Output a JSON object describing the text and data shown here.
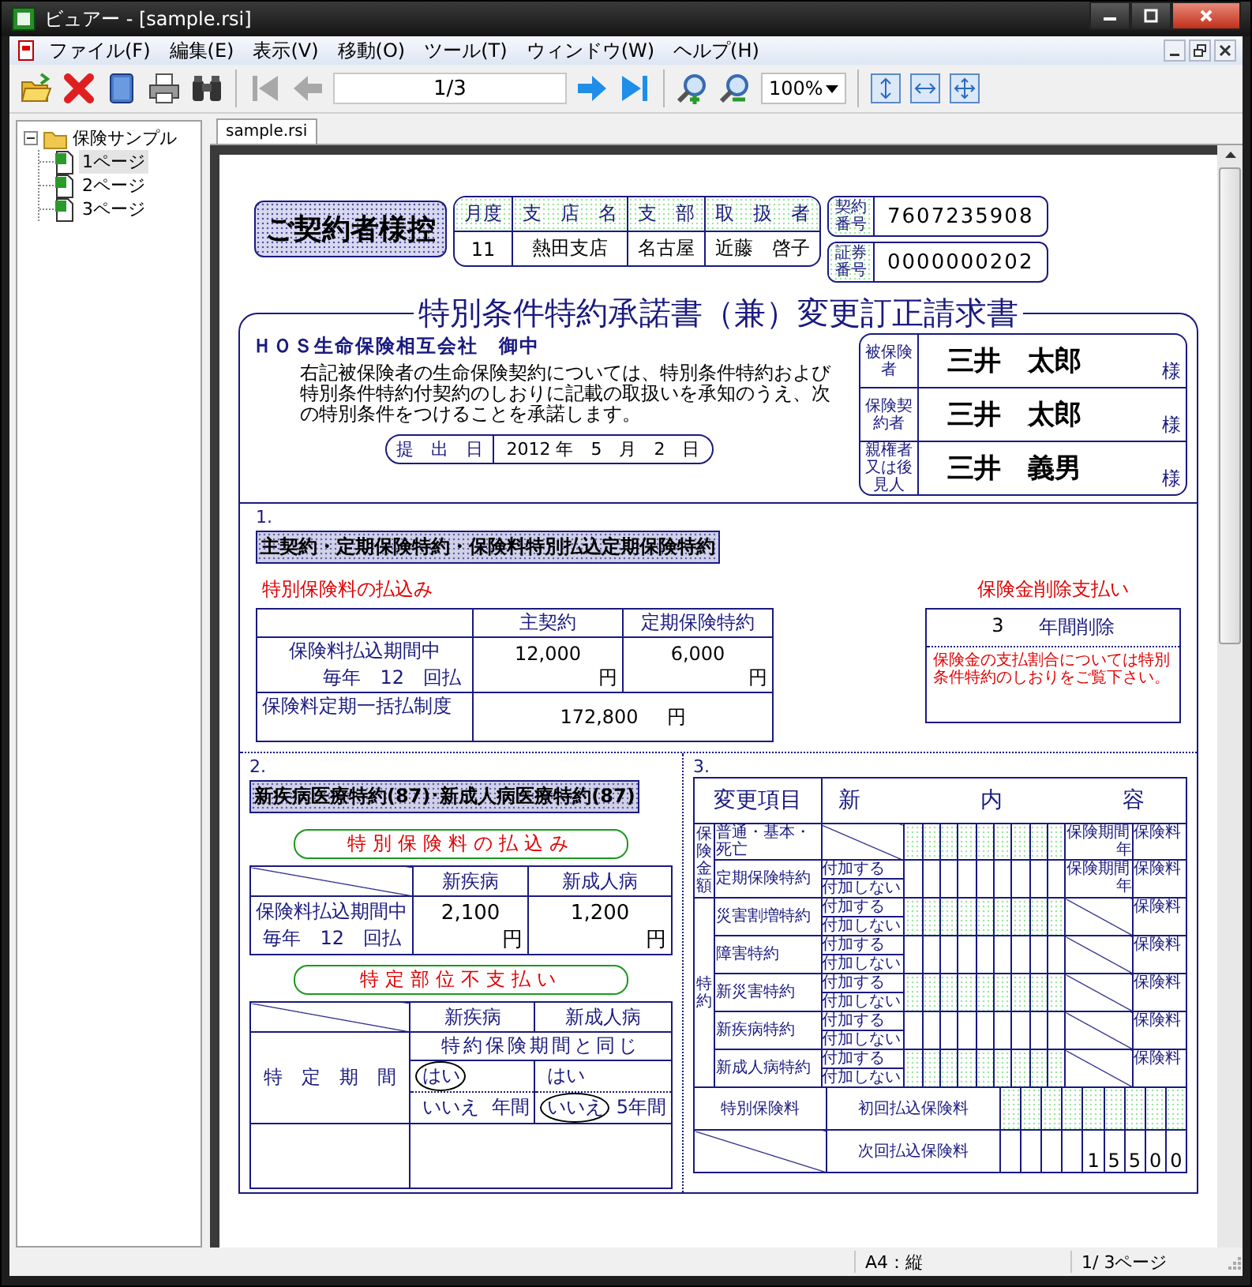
{
  "window": {
    "title": "ビュアー - [sample.rsi]"
  },
  "menu": [
    {
      "label": "ファイル(F)"
    },
    {
      "label": "編集(E)"
    },
    {
      "label": "表示(V)"
    },
    {
      "label": "移動(O)"
    },
    {
      "label": "ツール(T)"
    },
    {
      "label": "ウィンドウ(W)"
    },
    {
      "label": "ヘルプ(H)"
    }
  ],
  "toolbar": {
    "first_disabled": true,
    "previous_disabled": true,
    "next_disabled": false,
    "last_disabled": false,
    "page": "1/3",
    "zoom": "100%"
  },
  "tree": {
    "label": "保険サンプル",
    "expanded": true,
    "children": [
      {
        "label": "1ページ",
        "selected": true
      },
      {
        "label": "2ページ",
        "selected": false
      },
      {
        "label": "3ページ",
        "selected": false
      }
    ]
  },
  "tabs": [
    {
      "label": "sample.rsi",
      "selected": true
    }
  ],
  "document": {
    "header": {
      "stamp": "ご契約者様控",
      "agency_columns": [
        "月度",
        "支　店　名",
        "支　部",
        "取　扱　者"
      ],
      "agency_values": [
        "11",
        "熱田支店",
        "名古屋",
        "近藤　啓子"
      ],
      "numbers": [
        {
          "label": "契約番号",
          "value": "7607235908"
        },
        {
          "label": "証券番号",
          "value": "0000000202"
        }
      ]
    },
    "title": "特別条件特約承諾書（兼）変更訂正請求書",
    "addressee": "ＨＯＳ生命保険相互会社　御中",
    "body": "右記被保険者の生命保険契約については、特別条件特約および特別条件特約付契約のしおりに記載の取扱いを承知のうえ、次の特別条件をつけることを承諾します。",
    "submission": {
      "label": "提　出　日",
      "date": "2012 年　5　月　2　日"
    },
    "parties": [
      {
        "role": "被保険者",
        "name": "三井　太郎",
        "honorific": "様"
      },
      {
        "role": "保険契約者",
        "name": "三井　太郎",
        "honorific": "様"
      },
      {
        "role": "親権者又は後見人",
        "name": "三井　義男",
        "honorific": "様"
      }
    ],
    "section1": {
      "number": "1.",
      "heading": "主契約・定期保険特約・保険料特別払込定期保険特約",
      "premium_title": "特別保険料の払込み",
      "columns": [
        "主契約",
        "定期保険特約"
      ],
      "period_label": "保険料払込期間中",
      "frequency": "毎年　12　回払",
      "amounts": [
        {
          "amount": "12,000",
          "unit": "円"
        },
        {
          "amount": "6,000",
          "unit": "円"
        }
      ],
      "lump_label": "保険料定期一括払制度",
      "lump_amount": {
        "amount": "172,800",
        "unit": "円"
      },
      "reduction_title": "保険金削除支払い",
      "reduction_years": "3",
      "reduction_unit": "年間削除",
      "reduction_note": "保険金の支払割合については特別条件特約のしおりをご覧下さい。"
    },
    "section2": {
      "number": "2.",
      "heading": "新疾病医療特約(87)･新成人病医療特約(87)",
      "premium_title": "特別保険料の払込み",
      "columns": [
        "新疾病",
        "新成人病"
      ],
      "period_label": "保険料払込期間中",
      "frequency": "毎年　12　回払",
      "amounts": [
        {
          "amount": "2,100",
          "unit": "円"
        },
        {
          "amount": "1,200",
          "unit": "円"
        }
      ],
      "specific_title": "特定部位不支払い",
      "specific_columns": [
        "新疾病",
        "新成人病"
      ],
      "period_row_label": "特　定　期　間",
      "same_as_term": "特約保険期間と同じ",
      "choices": [
        {
          "options": [
            {
              "label": "はい",
              "selected": true
            },
            {
              "label": "いいえ",
              "selected": false
            }
          ],
          "years": "年間"
        },
        {
          "options": [
            {
              "label": "はい",
              "selected": false
            },
            {
              "label": "いいえ",
              "selected": true
            }
          ],
          "years": "5年間"
        }
      ]
    },
    "section3": {
      "number": "3.",
      "columns": [
        "変更項目",
        "新　　内　　容"
      ],
      "groups": [
        {
          "label": "保険金額",
          "items": [
            {
              "label": "普通・基本・死亡",
              "shaded": true,
              "period": "保険期間",
              "period_unit": "年",
              "premium": "保険料"
            },
            {
              "label": "定期保険特約",
              "options": [
                "付加する",
                "付加しない"
              ],
              "shaded": false,
              "period": "保険期間",
              "period_unit": "年",
              "premium": "保険料"
            }
          ]
        },
        {
          "label": "特約",
          "items": [
            {
              "label": "災害割増特約",
              "options": [
                "付加する",
                "付加しない"
              ],
              "shaded": true,
              "premium": "保険料"
            },
            {
              "label": "障害特約",
              "options": [
                "付加する",
                "付加しない"
              ],
              "shaded": false,
              "premium": "保険料"
            },
            {
              "label": "新災害特約",
              "options": [
                "付加する",
                "付加しない"
              ],
              "shaded": true,
              "premium": "保険料"
            },
            {
              "label": "新疾病特約",
              "options": [
                "付加する",
                "付加しない"
              ],
              "shaded": false,
              "premium": "保険料"
            },
            {
              "label": "新成人病特約",
              "options": [
                "付加する",
                "付加しない"
              ],
              "shaded": true,
              "premium": "保険料"
            }
          ]
        }
      ],
      "premium_rows": [
        {
          "group_label": "特別保険料",
          "label": "初回払込保険料",
          "shaded": true
        },
        {
          "label": "次回払込保険料",
          "shaded": false,
          "digits": [
            "1",
            "5",
            "5",
            "0",
            "0"
          ]
        }
      ]
    }
  },
  "status_bar": {
    "paper": "A4：縦",
    "pages": "1/ 3ページ"
  }
}
